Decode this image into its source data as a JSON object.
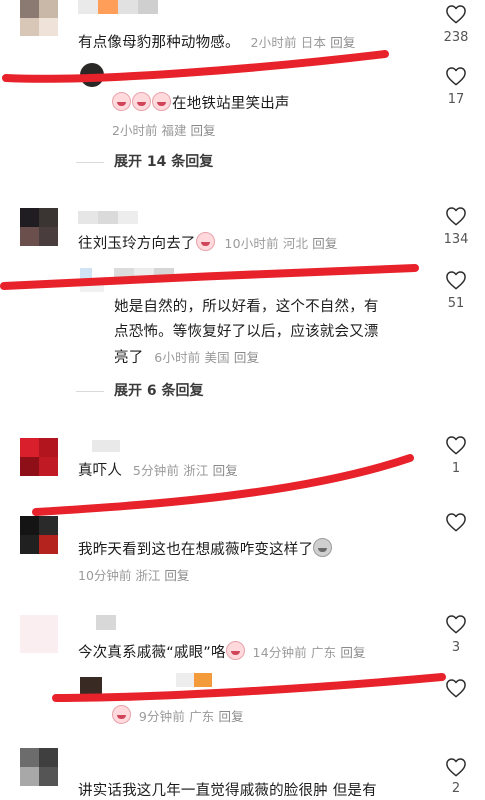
{
  "comments": [
    {
      "text": "有点像母豹那种动物感。",
      "time": "2小时前",
      "location": "日本",
      "reply": "回复",
      "likes": "238"
    },
    {
      "text": "在地铁站里笑出声",
      "time": "2小时前",
      "location": "福建",
      "reply": "回复",
      "likes": "17",
      "expand": "展开 14 条回复"
    },
    {
      "text": "往刘玉玲方向去了",
      "time": "10小时前",
      "location": "河北",
      "reply": "回复",
      "likes": "134"
    },
    {
      "lines": [
        "她是自然的，所以好看，这个不自然，有",
        "点恐怖。等恢复好了以后，应该就会又漂",
        "亮了"
      ],
      "time": "6小时前",
      "location": "美国",
      "reply": "回复",
      "likes": "51",
      "expand": "展开 6 条回复"
    },
    {
      "text": "真吓人",
      "time": "5分钟前",
      "location": "浙江",
      "reply": "回复",
      "likes": "1"
    },
    {
      "text": "我昨天看到这也在想戚薇咋变这样了",
      "time": "10分钟前",
      "location": "浙江",
      "reply": "回复",
      "likes": ""
    },
    {
      "text": "今次真系戚薇“戚眼”咯",
      "time": "14分钟前",
      "location": "广东",
      "reply": "回复",
      "likes": "3"
    },
    {
      "text": "",
      "time": "9分钟前",
      "location": "广东",
      "reply": "回复",
      "likes": ""
    },
    {
      "text": "讲实话我这几年一直觉得戚薇的脸很肿 但是有",
      "likes": "2"
    }
  ],
  "icons": {
    "like": "heart-outline-icon",
    "emoji_cry": "laugh-cry-emoji-icon",
    "emoji_poop": "poop-emoji-icon"
  },
  "colors": {
    "annotation_red": "#e8222b",
    "meta_grey": "#9a9a9a"
  }
}
